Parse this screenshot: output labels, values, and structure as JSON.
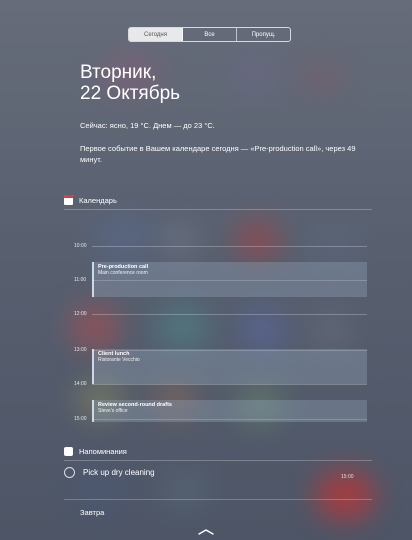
{
  "tabs": [
    "Сегодня",
    "Все",
    "Пропущ."
  ],
  "active_tab": 0,
  "date_line1": "Вторник,",
  "date_line2": "22 Октябрь",
  "weather": "Сейчас: ясно, 19 °C. Днем — до 23 °C.",
  "event_note": "Первое событие в Вашем календаре сегодня — «Pre-production call», через 49 минут.",
  "calendar": {
    "title": "Календарь",
    "hours": [
      "10:00",
      "11:00",
      "12:00",
      "13:00",
      "14:00",
      "15:00"
    ],
    "events": [
      {
        "title": "Pre-production call",
        "location": "Main conference room"
      },
      {
        "title": "Client lunch",
        "location": "Ristorante Vecchio"
      },
      {
        "title": "Review second-round drafts",
        "location": "Steve's office"
      }
    ]
  },
  "reminders": {
    "title": "Напоминания",
    "items": [
      {
        "text": "Pick up dry cleaning",
        "time": "15:00"
      }
    ]
  },
  "tomorrow": "Завтра",
  "colors": {
    "calendar_icon_red": "#e0393e",
    "background": "#5b6270"
  }
}
